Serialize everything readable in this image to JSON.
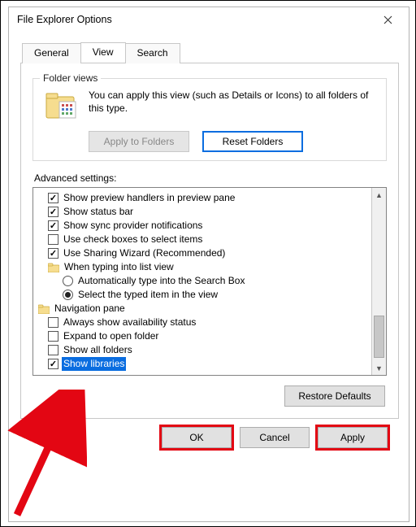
{
  "window": {
    "title": "File Explorer Options"
  },
  "tabs": {
    "general": "General",
    "view": "View",
    "search": "Search",
    "active": "View"
  },
  "folderViews": {
    "legend": "Folder views",
    "text": "You can apply this view (such as Details or Icons) to all folders of this type.",
    "applyBtn": "Apply to Folders",
    "resetBtn": "Reset Folders"
  },
  "advanced": {
    "label": "Advanced settings:",
    "items": [
      {
        "kind": "check",
        "checked": true,
        "indent": 0,
        "label": "Show preview handlers in preview pane"
      },
      {
        "kind": "check",
        "checked": true,
        "indent": 0,
        "label": "Show status bar"
      },
      {
        "kind": "check",
        "checked": true,
        "indent": 0,
        "label": "Show sync provider notifications"
      },
      {
        "kind": "check",
        "checked": false,
        "indent": 0,
        "label": "Use check boxes to select items"
      },
      {
        "kind": "check",
        "checked": true,
        "indent": 0,
        "label": "Use Sharing Wizard (Recommended)"
      },
      {
        "kind": "folder",
        "indent": 0,
        "label": "When typing into list view"
      },
      {
        "kind": "radio",
        "checked": false,
        "indent": 1,
        "label": "Automatically type into the Search Box"
      },
      {
        "kind": "radio",
        "checked": true,
        "indent": 1,
        "label": "Select the typed item in the view"
      },
      {
        "kind": "folder",
        "indent": -1,
        "label": "Navigation pane"
      },
      {
        "kind": "check",
        "checked": false,
        "indent": 0,
        "label": "Always show availability status"
      },
      {
        "kind": "check",
        "checked": false,
        "indent": 0,
        "label": "Expand to open folder"
      },
      {
        "kind": "check",
        "checked": false,
        "indent": 0,
        "label": "Show all folders"
      },
      {
        "kind": "check",
        "checked": true,
        "indent": 0,
        "label": "Show libraries",
        "selected": true
      }
    ],
    "restore": "Restore Defaults"
  },
  "buttons": {
    "ok": "OK",
    "cancel": "Cancel",
    "apply": "Apply"
  }
}
